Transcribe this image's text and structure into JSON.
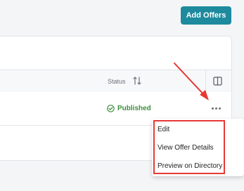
{
  "toolbar": {
    "add_offers_label": "Add Offers"
  },
  "table": {
    "status_header": "Status",
    "rows": [
      {
        "status": "Published"
      }
    ]
  },
  "row_menu": {
    "items": [
      {
        "label": "Edit"
      },
      {
        "label": "View Offer Details"
      },
      {
        "label": "Preview on Directory"
      }
    ]
  },
  "colors": {
    "primary": "#1d8a9e",
    "published": "#3d8f3d",
    "annotation": "#e53935"
  },
  "icons": {
    "sort": "sort-arrows-icon",
    "columns": "columns-icon",
    "status": "check-circle-icon",
    "row_actions": "more-horizontal-icon"
  }
}
